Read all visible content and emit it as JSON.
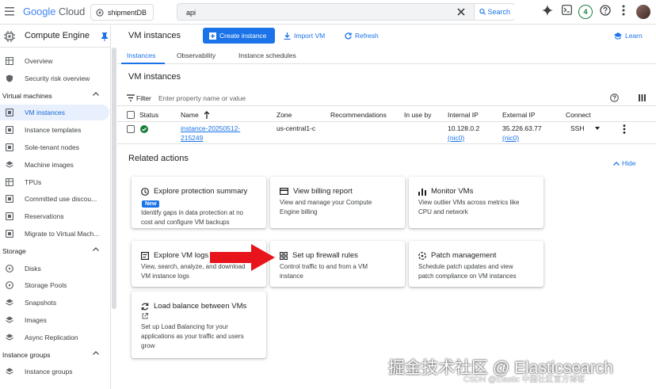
{
  "topbar": {
    "brand_google": "Google",
    "brand_cloud": "Cloud",
    "project": "shipmentDB",
    "search_value": "api",
    "search_button": "Search",
    "notifications_count": "4"
  },
  "sidebar": {
    "product": "Compute Engine",
    "items": [
      {
        "label": "Overview"
      },
      {
        "label": "Security risk overview"
      }
    ],
    "groups": [
      {
        "label": "Virtual machines",
        "items": [
          "VM instances",
          "Instance templates",
          "Sole-tenant nodes",
          "Machine images",
          "TPUs",
          "Committed use discou...",
          "Reservations",
          "Migrate to Virtual Mach..."
        ]
      },
      {
        "label": "Storage",
        "items": [
          "Disks",
          "Storage Pools",
          "Snapshots",
          "Images",
          "Async Replication"
        ]
      },
      {
        "label": "Instance groups",
        "items": [
          "Instance groups"
        ]
      }
    ]
  },
  "header": {
    "title": "VM instances",
    "create": "Create instance",
    "import": "Import VM",
    "refresh": "Refresh",
    "learn": "Learn"
  },
  "tabs": [
    "Instances",
    "Observability",
    "Instance schedules"
  ],
  "section_title": "VM instances",
  "filter": {
    "label": "Filter",
    "placeholder": "Enter property name or value"
  },
  "table": {
    "columns": [
      "Status",
      "Name",
      "Zone",
      "Recommendations",
      "In use by",
      "Internal IP",
      "External IP",
      "Connect"
    ],
    "rows": [
      {
        "name_line1": "instance-20250512-",
        "name_line2": "215249",
        "zone": "us-central1-c",
        "internal_ip": "10.128.0.2",
        "internal_nic": "(nic0)",
        "external_ip": "35.226.63.77",
        "external_nic": "(nic0)",
        "connect": "SSH"
      }
    ]
  },
  "related": {
    "title": "Related actions",
    "hide": "Hide",
    "cards": [
      {
        "title": "Explore protection summary",
        "badge": "New",
        "desc1": "Identify gaps in data protection at no",
        "desc2": "cost and configure VM backups"
      },
      {
        "title": "View billing report",
        "desc1": "View and manage your Compute",
        "desc2": "Engine billing"
      },
      {
        "title": "Monitor VMs",
        "desc1": "View outlier VMs across metrics like",
        "desc2": "CPU and network"
      },
      {
        "title": "Explore VM logs",
        "desc1": "View, search, analyze, and download",
        "desc2": "VM instance logs"
      },
      {
        "title": "Set up firewall rules",
        "desc1": "Control traffic to and from a VM",
        "desc2": "instance"
      },
      {
        "title": "Patch management",
        "desc1": "Schedule patch updates and view",
        "desc2": "patch compliance on VM instances"
      },
      {
        "title": "Load balance between VMs",
        "desc1": "Set up Load Balancing for your",
        "desc2": "applications as your traffic and users",
        "desc3": "grow"
      }
    ]
  },
  "watermark": {
    "main": "掘金技术社区 @ Elasticsearch",
    "sub": "CSDN @Elastic 中国社区官方博客"
  },
  "colors": {
    "accent": "#1a73e8",
    "arrow": "#e8141b",
    "running": "#188038"
  }
}
